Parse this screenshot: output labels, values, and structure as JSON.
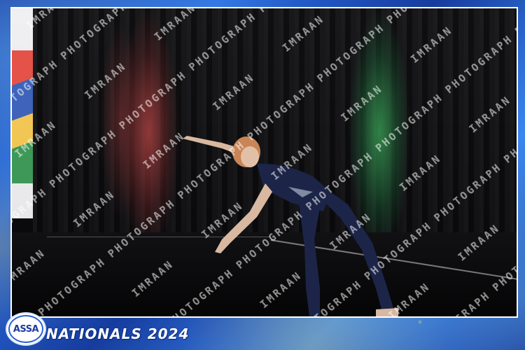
{
  "photo": {
    "description_hidden": false,
    "watermark_text": "IMRAAN PHOTOGRAPHY",
    "colors": {
      "frame_blue": "#1d47b8",
      "frame_light_blue": "#3a86f0",
      "gold_splash": "#e6be3c",
      "red_light": "#be4646",
      "green_light": "#3caa5a",
      "costume": "#1c2548"
    }
  },
  "branding": {
    "logo_text": "ASSA",
    "event_title": "NATIONALS 2024"
  }
}
